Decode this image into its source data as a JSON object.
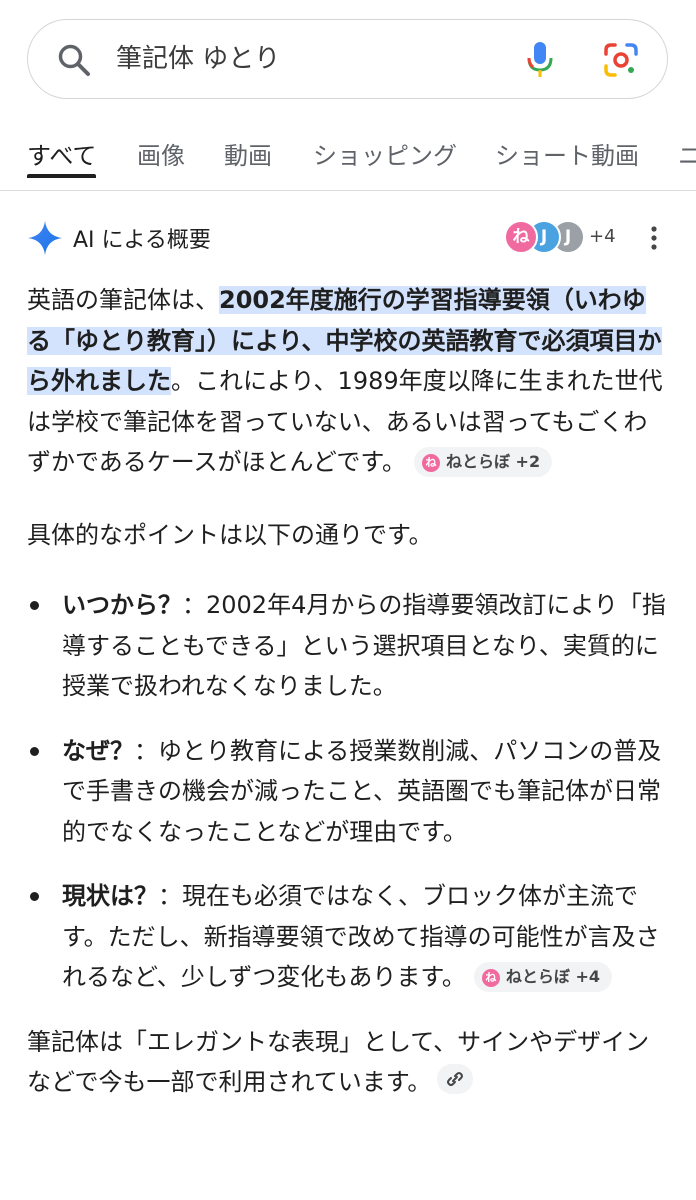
{
  "search": {
    "query": "筆記体 ゆとり"
  },
  "tabs": [
    {
      "label": "すべて"
    },
    {
      "label": "画像"
    },
    {
      "label": "動画"
    },
    {
      "label": "ショッピング"
    },
    {
      "label": "ショート動画"
    },
    {
      "label": "ニ"
    }
  ],
  "ai_overview": {
    "title": "AI による概要",
    "avatars": [
      "ね",
      "J",
      "J"
    ],
    "source_count": "+4",
    "intro_prefix": "英語の筆記体は、",
    "intro_highlight": "2002年度施行の学習指導要領（いわゆる「ゆとり教育」）により、中学校の英語教育で必須項目から外れました",
    "intro_suffix": "。これにより、1989年度以降に生まれた世代は学校で筆記体を習っていない、あるいは習ってもごくわずかであるケースがほとんどです。",
    "intro_chip": {
      "icon": "ね",
      "label": "ねとらぼ +2"
    },
    "points_intro": "具体的なポイントは以下の通りです。",
    "points": [
      {
        "label": "いつから？",
        "text": "：2002年4月からの指導要領改訂により「指導することもできる」という選択項目となり、実質的に授業で扱われなくなりました。"
      },
      {
        "label": "なぜ？",
        "text": "：ゆとり教育による授業数削減、パソコンの普及で手書きの機会が減ったこと、英語圏でも筆記体が日常的でなくなったことなどが理由です。"
      },
      {
        "label": "現状は？",
        "text": "：現在も必須ではなく、ブロック体が主流です。ただし、新指導要領で改めて指導の可能性が言及されるなど、少しずつ変化もあります。"
      }
    ],
    "points_chip": {
      "icon": "ね",
      "label": "ねとらぼ +4"
    },
    "closing": "筆記体は「エレガントな表現」として、サインやデザインなどで今も一部で利用されています。"
  }
}
